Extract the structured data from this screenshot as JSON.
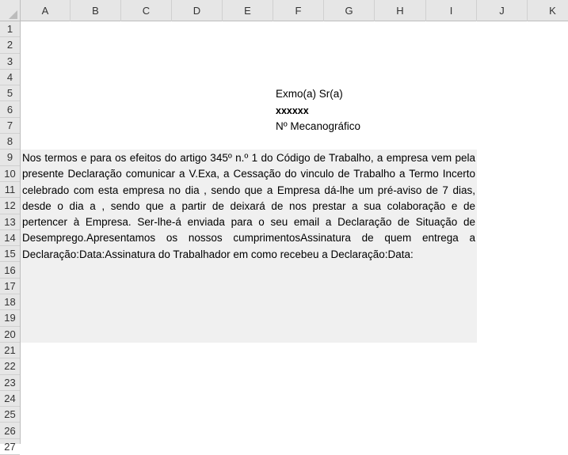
{
  "columns": [
    "A",
    "B",
    "C",
    "D",
    "E",
    "F",
    "G",
    "H",
    "I",
    "J",
    "K"
  ],
  "rows": [
    "1",
    "2",
    "3",
    "4",
    "5",
    "6",
    "7",
    "8",
    "9",
    "10",
    "11",
    "12",
    "13",
    "14",
    "15",
    "16",
    "17",
    "18",
    "19",
    "20",
    "21",
    "22",
    "23",
    "24",
    "25",
    "26",
    "27"
  ],
  "cells": {
    "F5": "Exmo(a) Sr(a)",
    "F6": "xxxxxx",
    "F7": "Nº Mecanográfico"
  },
  "paragraph_lines": [
    "Nos termos e para os efeitos do artigo 345º n.º 1 do Código de Trabalho, a empresa vem pela",
    "presente Declaração comunicar a V.Exa, a Cessação do vinculo de Trabalho a Termo Incerto",
    "celebrado com esta empresa no dia , sendo que a Empresa dá-lhe um pré-aviso de 7 dias,",
    "desde o dia  a , sendo que a partir de deixará de nos prestar a sua colaboração e de",
    "pertencer à Empresa. Ser-lhe-á enviada para o seu email a Declaração de Situação de",
    "Desemprego.Apresentamos os nossos cumprimentosAssinatura de quem entrega a",
    "Declaração:Data:Assinatura do Trabalhador em como recebeu a Declaração:Data:"
  ]
}
